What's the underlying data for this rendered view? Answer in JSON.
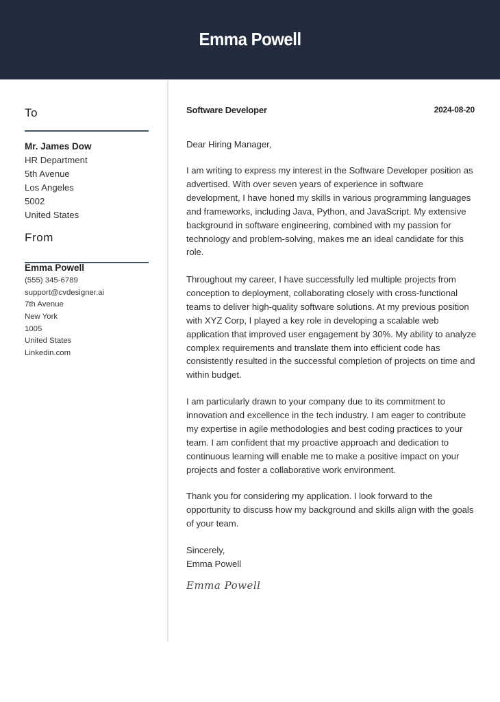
{
  "header": {
    "name": "Emma Powell",
    "background_color": "#232c3e"
  },
  "recipient": {
    "section_title": "To",
    "name": "Mr. James Dow",
    "lines": [
      "HR Department",
      "5th Avenue",
      "Los Angeles",
      "5002",
      "United States"
    ]
  },
  "sender": {
    "section_title": "From",
    "name": "Emma Powell",
    "lines": [
      "(555) 345-6789",
      "support@cvdesigner.ai",
      "7th Avenue",
      "New York",
      "1005",
      "United States",
      "Linkedin.com"
    ]
  },
  "letter": {
    "job_title": "Software Developer",
    "date": "2024-08-20",
    "salutation": "Dear Hiring Manager,",
    "paragraphs": [
      "I am writing to express my interest in the Software Developer position as advertised. With over seven years of experience in software development, I have honed my skills in various programming languages and frameworks, including Java, Python, and JavaScript. My extensive background in software engineering, combined with my passion for technology and problem-solving, makes me an ideal candidate for this role.",
      "Throughout my career, I have successfully led multiple projects from conception to deployment, collaborating closely with cross-functional teams to deliver high-quality software solutions. At my previous position with XYZ Corp, I played a key role in developing a scalable web application that improved user engagement by 30%. My ability to analyze complex requirements and translate them into efficient code has consistently resulted in the successful completion of projects on time and within budget.",
      "I am particularly drawn to your company due to its commitment to innovation and excellence in the tech industry. I am eager to contribute my expertise in agile methodologies and best coding practices to your team. I am confident that my proactive approach and dedication to continuous learning will enable me to make a positive impact on your projects and foster a collaborative work environment.",
      "Thank you for considering my application. I look forward to the opportunity to discuss how my background and skills align with the goals of your team."
    ],
    "closing": "Sincerely,",
    "closing_name": "Emma Powell",
    "signature": "Emma Powell"
  }
}
